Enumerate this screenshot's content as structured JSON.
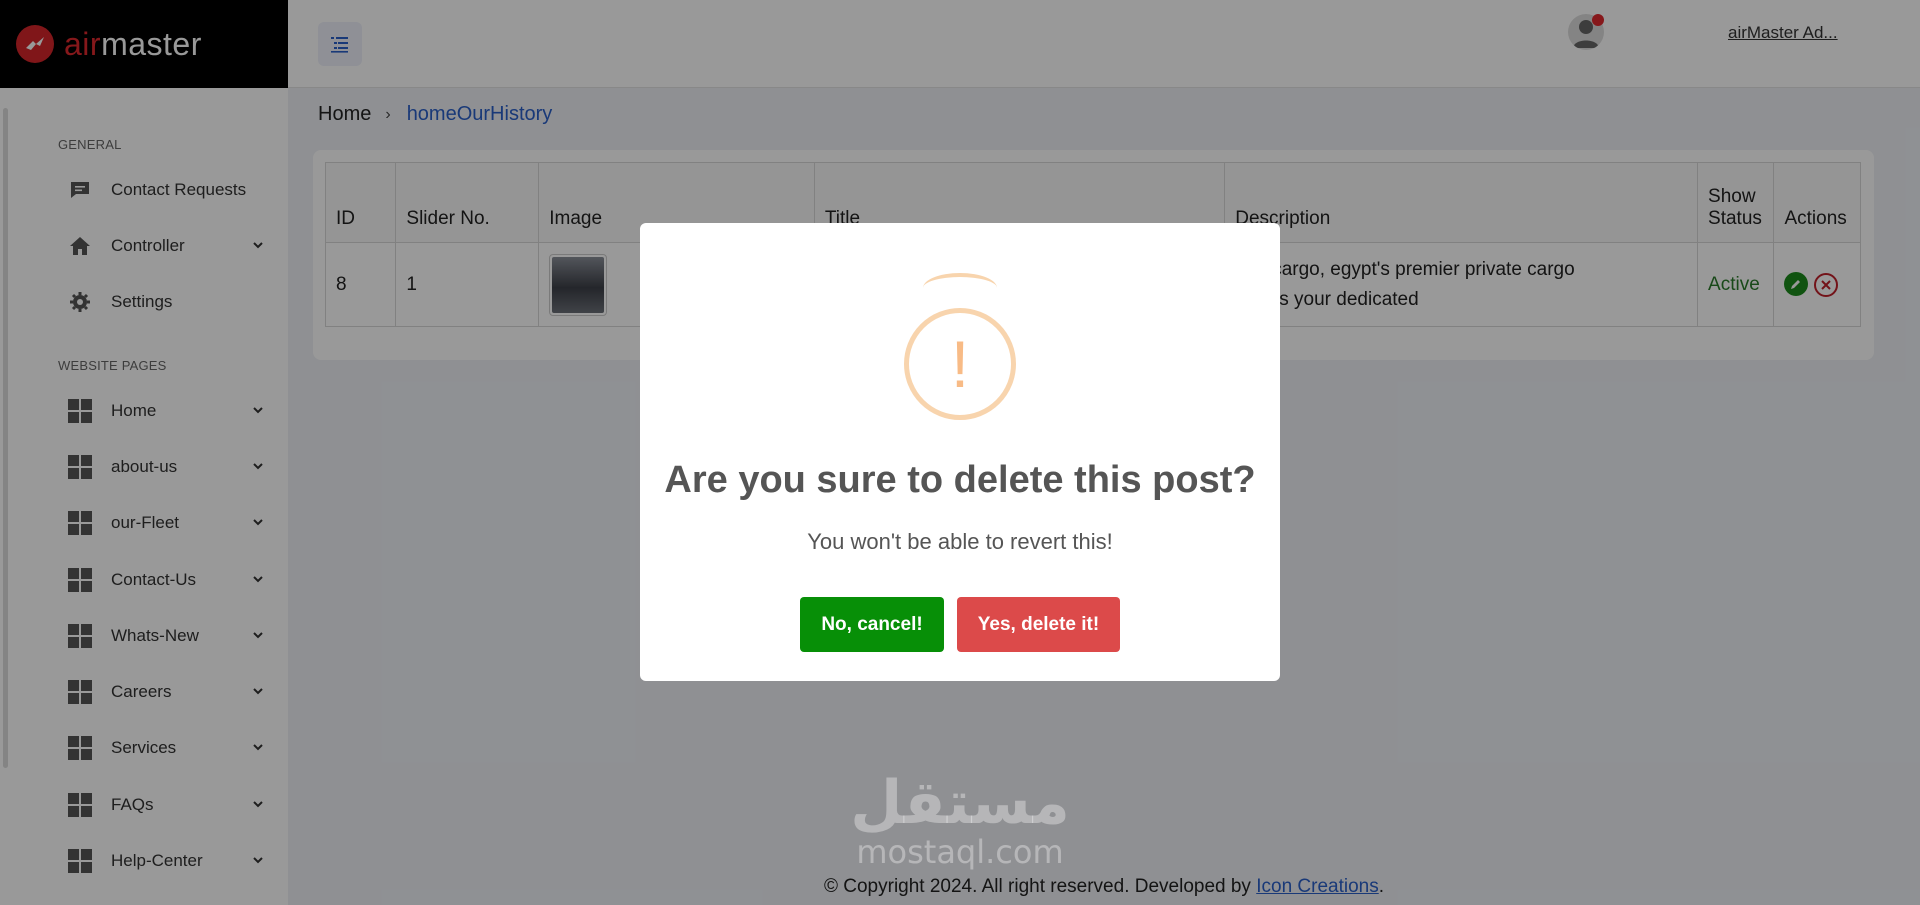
{
  "brand": {
    "name_part1": "air",
    "name_part2": "master"
  },
  "sidebar": {
    "section_general": "GENERAL",
    "section_website": "WEBSITE PAGES",
    "general_items": [
      {
        "label": "Contact Requests",
        "icon": "message-icon"
      },
      {
        "label": "Controller",
        "icon": "home-icon"
      },
      {
        "label": "Settings",
        "icon": "gear-icon"
      }
    ],
    "page_items": [
      {
        "label": "Home"
      },
      {
        "label": "about-us"
      },
      {
        "label": "our-Fleet"
      },
      {
        "label": "Contact-Us"
      },
      {
        "label": "Whats-New"
      },
      {
        "label": "Careers"
      },
      {
        "label": "Services"
      },
      {
        "label": "FAQs"
      },
      {
        "label": "Help-Center"
      }
    ]
  },
  "header": {
    "user_name": "airMaster Ad..."
  },
  "breadcrumb": {
    "home": "Home",
    "current": "homeOurHistory"
  },
  "table": {
    "headers": [
      "ID",
      "Slider No.",
      "Image",
      "Title",
      "Description",
      "Show Status",
      "Actions"
    ],
    "rows": [
      {
        "id": "8",
        "slider_no": "1",
        "title": "",
        "description_line1": "ster cargo, egypt's premier private cargo",
        "description_line2": "any, is your dedicated",
        "status": "Active"
      }
    ]
  },
  "dialog": {
    "icon": "!",
    "title": "Are you sure to delete this post?",
    "text": "You won't be able to revert this!",
    "cancel_label": "No, cancel!",
    "confirm_label": "Yes, delete it!"
  },
  "footer": {
    "text": "© Copyright 2024. All right reserved. Developed by ",
    "link": "Icon Creations",
    "suffix": "."
  },
  "watermark": {
    "arabic": "مستقل",
    "latin": "mostaql.com"
  },
  "colors": {
    "accent": "#2b5fc8",
    "danger": "#dc4a4a",
    "success": "#078f07",
    "warning": "#f8bb86",
    "brand_red": "#e0282e"
  }
}
